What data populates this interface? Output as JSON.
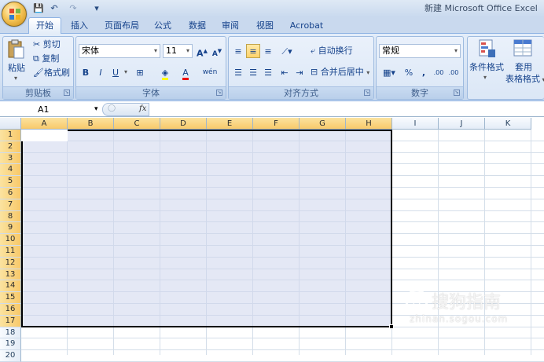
{
  "window": {
    "title": "新建 Microsoft Office Excel"
  },
  "qat": {
    "save": "💾",
    "undo": "↶",
    "redo": "↷",
    "customize": "▾"
  },
  "tabs": [
    "开始",
    "插入",
    "页面布局",
    "公式",
    "数据",
    "审阅",
    "视图",
    "Acrobat"
  ],
  "clipboard": {
    "paste": "粘贴",
    "cut": "剪切",
    "copy": "复制",
    "format_painter": "格式刷",
    "label": "剪贴板"
  },
  "font": {
    "name": "宋体",
    "size": "11",
    "grow": "A",
    "shrink": "A",
    "bold": "B",
    "italic": "I",
    "underline": "U",
    "wen": "wén",
    "label": "字体"
  },
  "alignment": {
    "wrap": "自动换行",
    "merge": "合并后居中",
    "label": "对齐方式"
  },
  "number": {
    "format": "常规",
    "percent": "%",
    "comma": ",",
    "inc_dec": ".00",
    "dec_dec": ".00",
    "label": "数字"
  },
  "styles": {
    "cond_fmt": "条件格式",
    "table_fmt_1": "套用",
    "table_fmt_2": "表格格式"
  },
  "formula_bar": {
    "name_box": "A1",
    "fx": "fx",
    "content": ""
  },
  "columns": [
    "A",
    "B",
    "C",
    "D",
    "E",
    "F",
    "G",
    "H",
    "I",
    "J",
    "K"
  ],
  "rows": [
    "1",
    "2",
    "3",
    "4",
    "5",
    "6",
    "7",
    "8",
    "9",
    "10",
    "11",
    "12",
    "13",
    "14",
    "15",
    "16",
    "17",
    "18",
    "19",
    "20"
  ],
  "watermark": {
    "text": "搜狗指南",
    "url": "zhinan.sogou.com"
  },
  "colors": {
    "accent": "#15428b",
    "selection_header": "#f8c96a",
    "ribbon": "#d3e1f3"
  }
}
